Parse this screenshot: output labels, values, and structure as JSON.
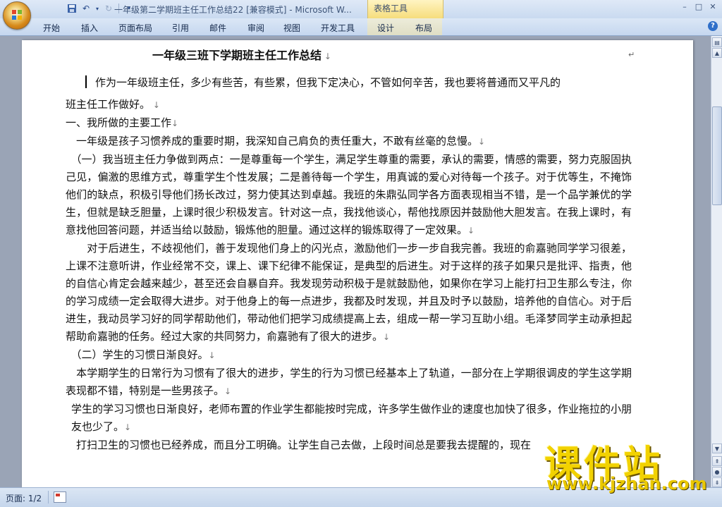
{
  "window": {
    "title": "一年级第二学期班主任工作总结22 [兼容模式] - Microsoft W...",
    "context_group": "表格工具",
    "controls": [
      "–",
      "□",
      "✕"
    ]
  },
  "ribbon": {
    "tabs": [
      "开始",
      "插入",
      "页面布局",
      "引用",
      "邮件",
      "审阅",
      "视图",
      "开发工具",
      "设计",
      "布局"
    ]
  },
  "document": {
    "title": "一年级三班下学期班主任工作总结",
    "paragraphs": [
      "作为一年级班主任，多少有些苦，有些累，但我下定决心，不管如何辛苦，我也要将普通而又平凡的",
      "班主任工作做好。",
      "一、我所做的主要工作",
      "　一年级是孩子习惯养成的重要时期，我深知自己肩负的责任重大，不敢有丝毫的怠慢。",
      "　（一）我当班主任力争做到两点：一是尊重每一个学生，满足学生尊重的需要，承认的需要，情感的需要，努力克服固执己见，偏激的思维方式，尊重学生个性发展；二是善待每一个学生，用真诚的爱心对待每一个孩子。对于优等生，不掩饰他们的缺点，积极引导他们扬长改过，努力使其达到卓越。我班的朱鼎弘同学各方面表现相当不错，是一个品学兼优的学生，但就是缺乏胆量，上课时很少积极发言。针对这一点，我找他谈心，帮他找原因并鼓励他大胆发言。在我上课时，有意找他回答问题，并适当给以鼓励，锻炼他的胆量。通过这样的锻炼取得了一定效果。",
      "　　对于后进生，不歧视他们，善于发现他们身上的闪光点，激励他们一步一步自我完善。我班的俞嘉驰同学学习很差，上课不注意听讲，作业经常不交，课上、课下纪律不能保证，是典型的后进生。对于这样的孩子如果只是批评、指责，他的自信心肯定会越来越少，甚至还会自暴自弃。我发现劳动积极于是就鼓励他，如果你在学习上能打扫卫生那么专注，你的学习成绩一定会取得大进步。对于他身上的每一点进步，我都及时发现，并且及时予以鼓励，培养他的自信心。对于后进生，我动员学习好的同学帮助他们，带动他们把学习成绩提高上去，组成一帮一学习互助小组。毛泽梦同学主动承担起帮助俞嘉驰的任务。经过大家的共同努力，俞嘉驰有了很大的进步。",
      "　（二）学生的习惯日渐良好。",
      "　本学期学生的日常行为习惯有了很大的进步，学生的行为习惯已经基本上了轨道，一部分在上学期很调皮的学生这学期表现都不错，特别是一些男孩子。",
      "学生的学习习惯也日渐良好，老师布置的作业学生都能按时完成，许多学生做作业的速度也加快了很多，作业拖拉的小朋友也少了。",
      "　打扫卫生的习惯也已经养成，而且分工明确。让学生自己去做，上段时间总是要我去提醒的，现在"
    ]
  },
  "statusbar": {
    "pages": "页面: 1/2"
  },
  "watermark": {
    "main": "课件站",
    "url": "www.kjzhan.com"
  }
}
